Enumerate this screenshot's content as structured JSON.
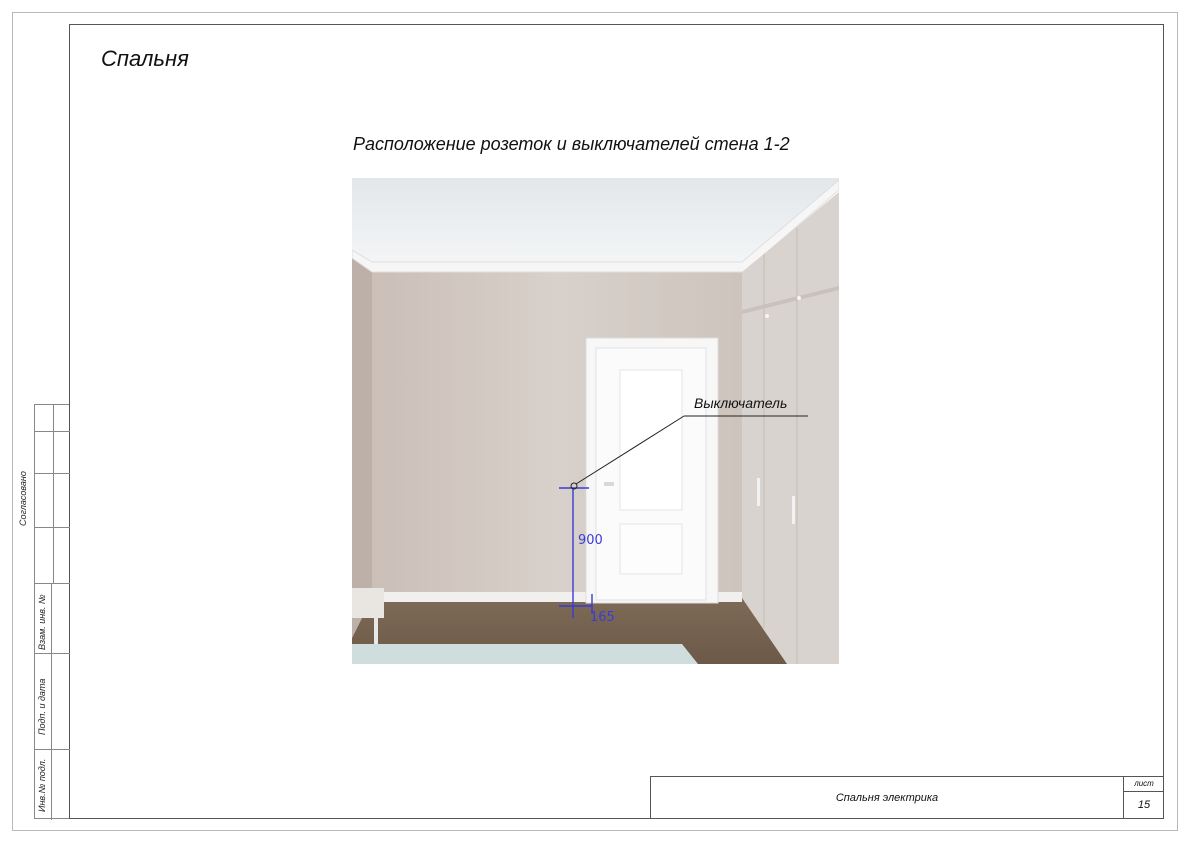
{
  "sheet": {
    "room_title": "Спальня",
    "view_title": "Расположение розеток и выключателей стена 1-2"
  },
  "side_table": {
    "approved": "Согласовано",
    "inv_replace": "Взам. инв. №",
    "sign_date": "Подп. и дата",
    "inv_orig": "Инв.№ подл."
  },
  "drawing": {
    "callout_label": "Выключатель",
    "dim_height": "900",
    "dim_offset": "165"
  },
  "stamp": {
    "name": "Спальня электрика",
    "sheet_label": "лист",
    "sheet_number": "15"
  },
  "colors": {
    "wall": "#cfc5bf",
    "ceiling": "#e9ecee",
    "floor": "#7a6654",
    "dimension": "#3b3bd6"
  }
}
